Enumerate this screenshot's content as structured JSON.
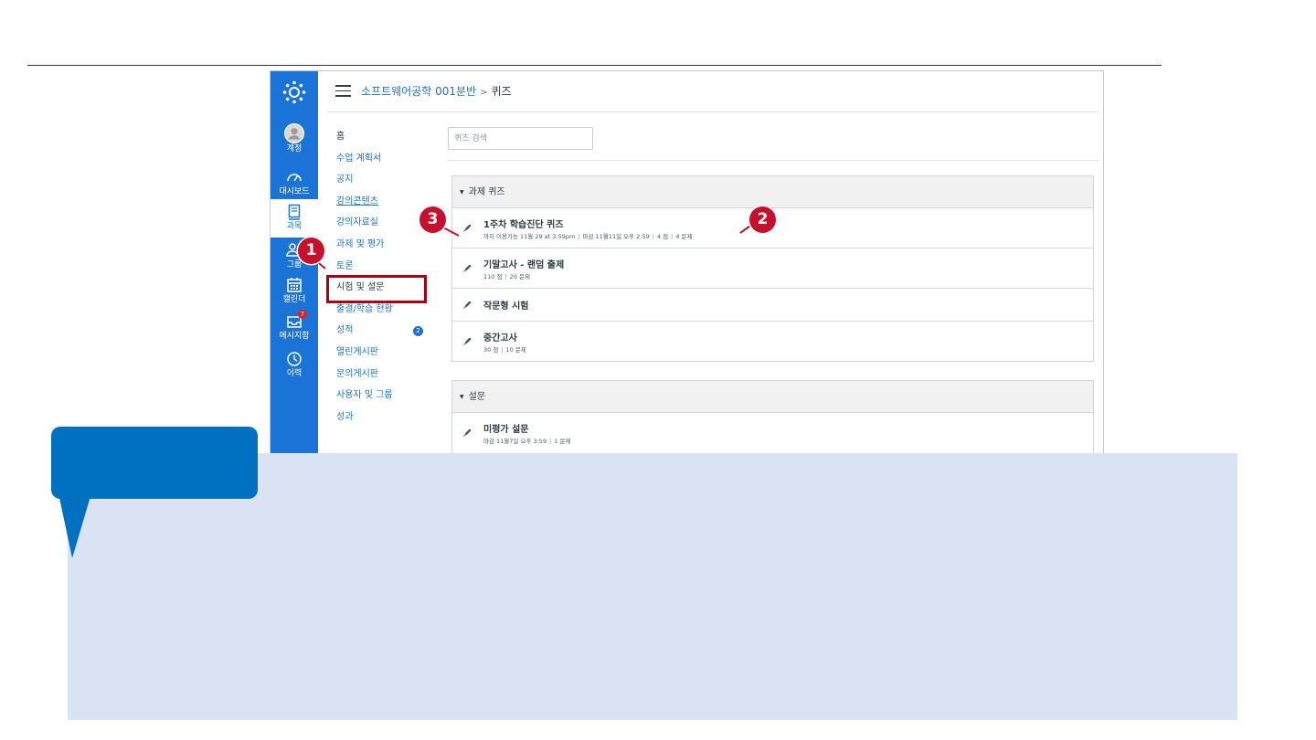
{
  "global_nav": {
    "items": [
      {
        "label": "계정",
        "icon": "user-avatar-icon"
      },
      {
        "label": "대시보드",
        "icon": "speedometer-icon"
      },
      {
        "label": "과목",
        "icon": "book-icon"
      },
      {
        "label": "그룹",
        "icon": "group-icon"
      },
      {
        "label": "캘린더",
        "icon": "calendar-icon"
      },
      {
        "label": "메시지함",
        "icon": "inbox-icon",
        "badge": "7"
      },
      {
        "label": "이력",
        "icon": "clock-icon"
      }
    ],
    "color": "#1a73d6"
  },
  "breadcrumb": {
    "course": "소프트웨어공학 001분반",
    "separator": ">",
    "current": "퀴즈"
  },
  "course_nav": {
    "items": [
      {
        "label": "홈"
      },
      {
        "label": "수업 계획서"
      },
      {
        "label": "공지"
      },
      {
        "label": "강의콘텐츠"
      },
      {
        "label": "강의자료실"
      },
      {
        "label": "과제 및 평가"
      },
      {
        "label": "토론"
      },
      {
        "label": "시험 및 설문"
      },
      {
        "label": "출결/학습 현황"
      },
      {
        "label": "성적",
        "badge": "2"
      },
      {
        "label": "열린게시판"
      },
      {
        "label": "문의게시판"
      },
      {
        "label": "사용자 및 그룹"
      },
      {
        "label": "성과"
      }
    ]
  },
  "search": {
    "placeholder": "퀴즈 검색"
  },
  "sections": [
    {
      "title": "과제 퀴즈",
      "quizzes": [
        {
          "title": "1주차 학습진단 퀴즈",
          "meta": [
            "까지 이용가능 11월 29 at 3:59pm",
            "마감 11월11일 오후 2:59",
            "4 점",
            "4 문제"
          ]
        },
        {
          "title": "기말고사 - 랜덤 출제",
          "meta": [
            "110 점",
            "20 문제"
          ]
        },
        {
          "title": "작문형 시험",
          "meta": []
        },
        {
          "title": "중간고사",
          "meta": [
            "30 점",
            "10 문제"
          ]
        }
      ]
    },
    {
      "title": "설문",
      "quizzes": [
        {
          "title": "미평가 설문",
          "meta": [
            "마감 11월7일 오후 3:59",
            "1 문제"
          ]
        }
      ]
    }
  ],
  "annotations": {
    "markers": [
      "1",
      "2",
      "3"
    ],
    "marker_color": "#c8102e",
    "highlight_color": "#b00010"
  },
  "callout": {
    "tab_color": "#0070c0",
    "panel_color": "#dae3f3"
  }
}
